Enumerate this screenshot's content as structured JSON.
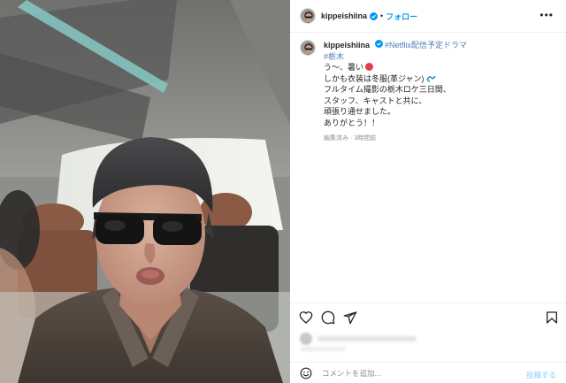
{
  "account": {
    "username": "kippeishiina",
    "verified_icon": "verified-badge-icon",
    "follow_label": "フォロー",
    "separator": "•"
  },
  "caption": {
    "username": "kippeishiina",
    "hashtags": [
      "#Netflix配信予定ドラマ",
      "#栃木"
    ],
    "lines": [
      "う〜、暑い",
      "しかも衣装は冬服(革ジャン)",
      "フルタイム撮影の栃木ロケ三日間、",
      "スタッフ、キャストと共に、",
      "頑張り通せました。",
      "ありがとう！！"
    ],
    "meta": "編集済み · 3時間前"
  },
  "actions": {
    "like": "heart-icon",
    "comment": "comment-icon",
    "share": "send-icon",
    "save": "bookmark-icon"
  },
  "comment_box": {
    "placeholder": "コメントを追加...",
    "post_label": "投稿する"
  },
  "colors": {
    "link": "#0095f6",
    "hashtag": "#4f7bb4",
    "muted": "#8e8e8e",
    "post_disabled": "#b2dffc"
  }
}
